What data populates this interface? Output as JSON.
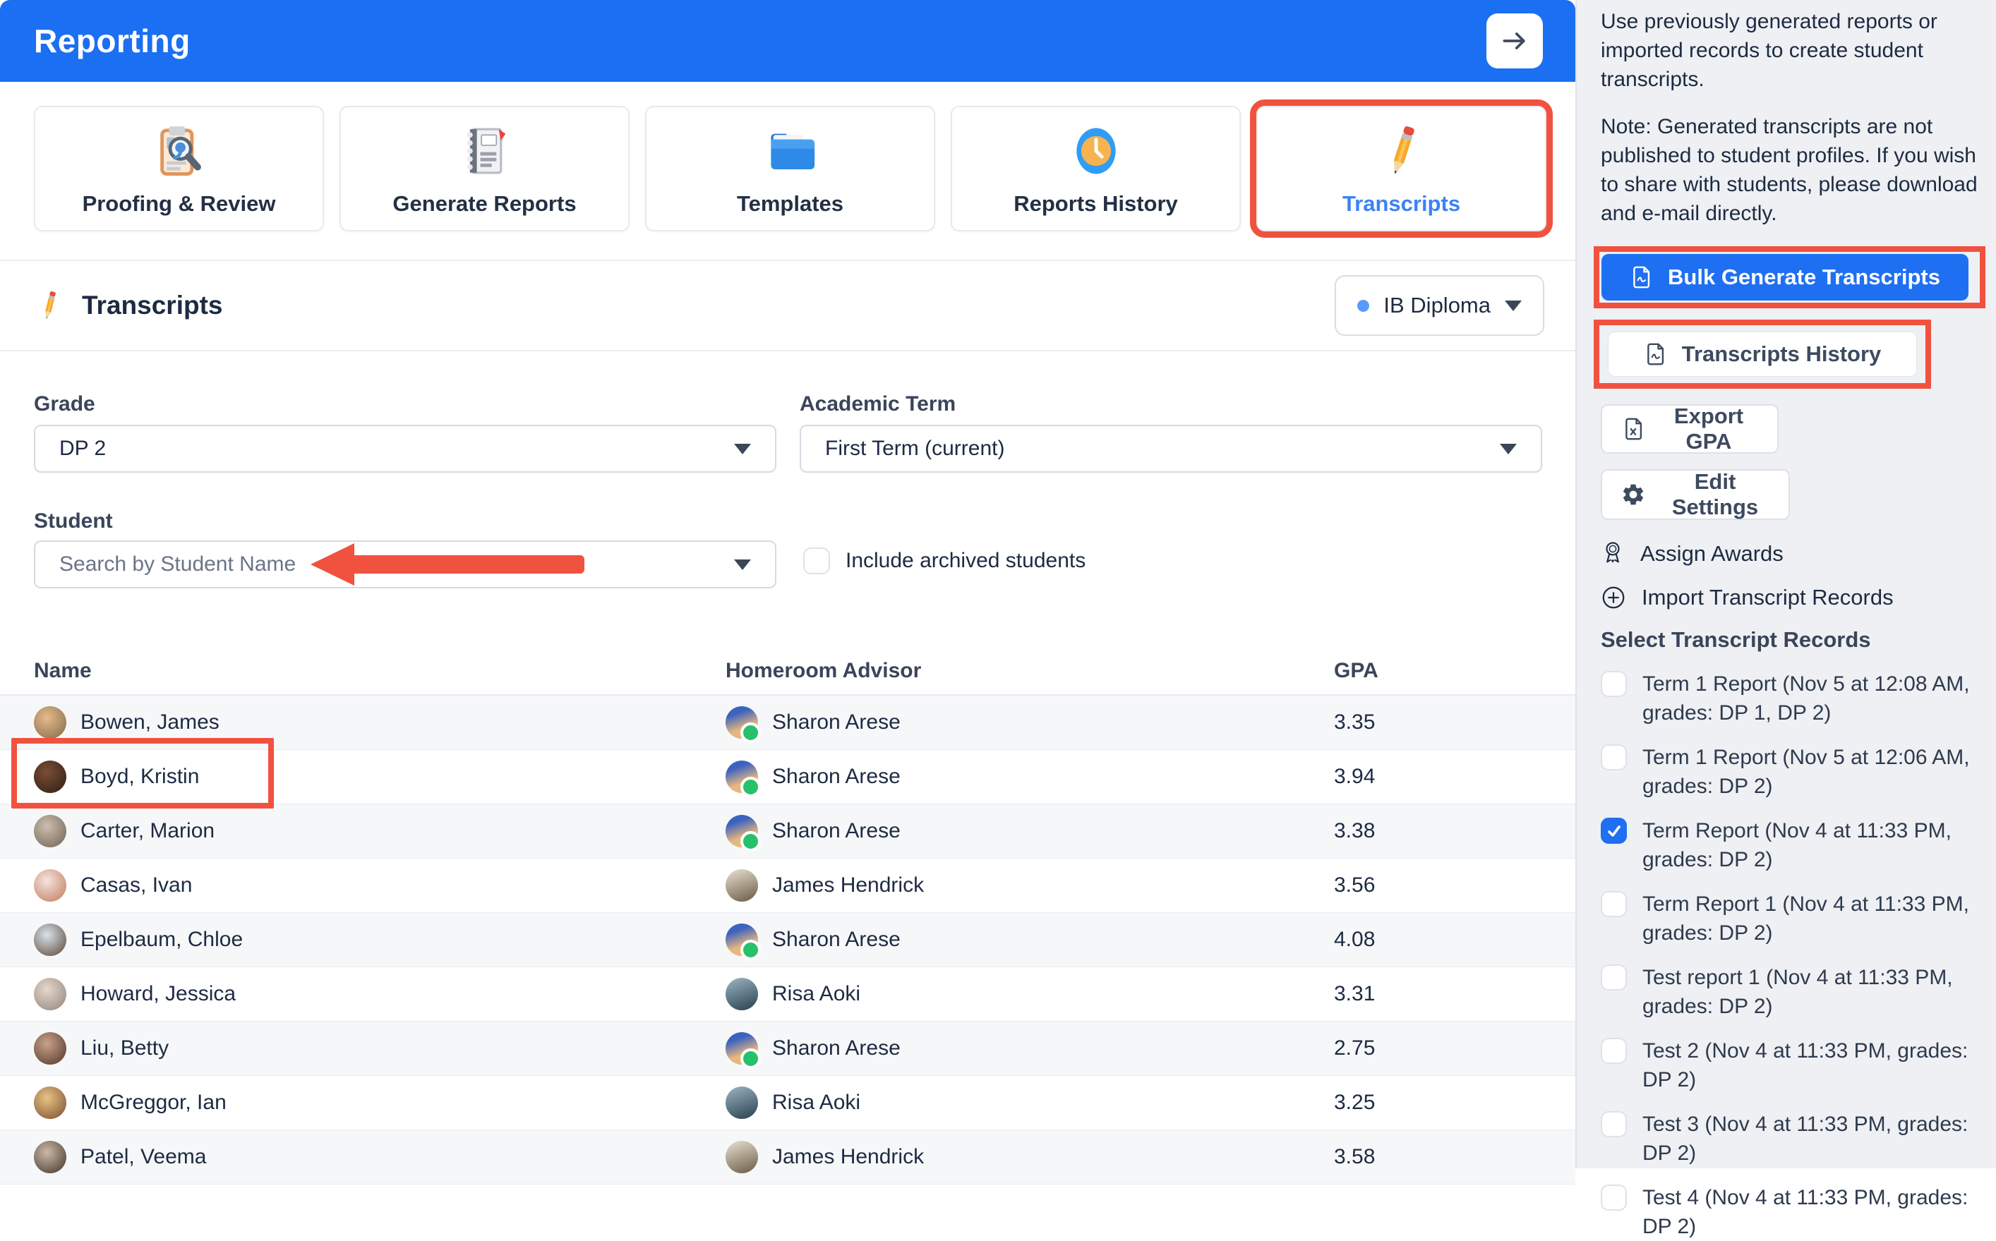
{
  "header": {
    "title": "Reporting",
    "collapse_icon": "arrow-right-icon"
  },
  "tabs": [
    {
      "label": "Proofing & Review",
      "icon": "proofing-review-icon",
      "active": false
    },
    {
      "label": "Generate Reports",
      "icon": "report-cards-icon",
      "active": false
    },
    {
      "label": "Templates",
      "icon": "folder-icon",
      "active": false
    },
    {
      "label": "Reports History",
      "icon": "clock-icon",
      "active": false
    },
    {
      "label": "Transcripts",
      "icon": "pencil-icon",
      "active": true,
      "annotated": true
    }
  ],
  "section": {
    "title": "Transcripts",
    "icon": "pencil-icon",
    "program_selector": {
      "label": "IB Diploma",
      "dot_color": "#5b9bf8"
    }
  },
  "filters": {
    "grade": {
      "label": "Grade",
      "value": "DP 2"
    },
    "academic_term": {
      "label": "Academic Term",
      "value": "First Term (current)"
    },
    "student": {
      "label": "Student",
      "placeholder": "Search by Student Name",
      "annotated_with_arrow": true
    },
    "include_archived": {
      "label": "Include archived students",
      "checked": false
    }
  },
  "table": {
    "columns": {
      "name": "Name",
      "advisor": "Homeroom Advisor",
      "gpa": "GPA"
    },
    "rows": [
      {
        "name": "Bowen, James",
        "advisor": "Sharon Arese",
        "gpa": "3.35",
        "advisor_online": true,
        "annotated": false
      },
      {
        "name": "Boyd, Kristin",
        "advisor": "Sharon Arese",
        "gpa": "3.94",
        "advisor_online": true,
        "annotated": true
      },
      {
        "name": "Carter, Marion",
        "advisor": "Sharon Arese",
        "gpa": "3.38",
        "advisor_online": true,
        "annotated": false
      },
      {
        "name": "Casas, Ivan",
        "advisor": "James Hendrick",
        "gpa": "3.56",
        "advisor_online": false,
        "annotated": false
      },
      {
        "name": "Epelbaum, Chloe",
        "advisor": "Sharon Arese",
        "gpa": "4.08",
        "advisor_online": true,
        "annotated": false
      },
      {
        "name": "Howard, Jessica",
        "advisor": "Risa Aoki",
        "gpa": "3.31",
        "advisor_online": false,
        "annotated": false
      },
      {
        "name": "Liu, Betty",
        "advisor": "Sharon Arese",
        "gpa": "2.75",
        "advisor_online": true,
        "annotated": false
      },
      {
        "name": "McGreggor, Ian",
        "advisor": "Risa Aoki",
        "gpa": "3.25",
        "advisor_online": false,
        "annotated": false
      },
      {
        "name": "Patel, Veema",
        "advisor": "James Hendrick",
        "gpa": "3.58",
        "advisor_online": false,
        "annotated": false
      }
    ]
  },
  "sidebar": {
    "intro": "Use previously generated reports or imported records to create student transcripts.",
    "note": "Note: Generated transcripts are not published to student profiles. If you wish to share with students, please download and e-mail directly.",
    "buttons": {
      "bulk": {
        "label": "Bulk Generate Transcripts",
        "icon": "pdf-file-icon",
        "annotated": true
      },
      "history": {
        "label": "Transcripts History",
        "icon": "pdf-file-icon",
        "annotated": true
      },
      "export_gpa": {
        "label": "Export GPA",
        "icon": "excel-file-icon",
        "annotated": false
      },
      "edit_settings": {
        "label": "Edit Settings",
        "icon": "gear-icon",
        "annotated": false
      }
    },
    "links": {
      "assign_awards": {
        "label": "Assign Awards",
        "icon": "award-icon"
      },
      "import_records": {
        "label": "Import Transcript Records",
        "icon": "plus-circle-icon"
      }
    },
    "records": {
      "heading": "Select Transcript Records",
      "items": [
        {
          "label": "Term 1 Report (Nov 5 at 12:08 AM, grades: DP 1, DP 2)",
          "checked": false
        },
        {
          "label": "Term 1 Report (Nov 5 at 12:06 AM, grades: DP 2)",
          "checked": false
        },
        {
          "label": "Term Report (Nov 4 at 11:33 PM, grades: DP 2)",
          "checked": true
        },
        {
          "label": "Term Report 1 (Nov 4 at 11:33 PM, grades: DP 2)",
          "checked": false
        },
        {
          "label": "Test report 1 (Nov 4 at 11:33 PM, grades: DP 2)",
          "checked": false
        },
        {
          "label": "Test 2 (Nov 4 at 11:33 PM, grades: DP 2)",
          "checked": false
        },
        {
          "label": "Test 3 (Nov 4 at 11:33 PM, grades: DP 2)",
          "checked": false
        },
        {
          "label": "Test 4 (Nov 4 at 11:33 PM, grades: DP 2)",
          "checked": false
        }
      ]
    }
  },
  "colors": {
    "header_blue": "#1b6ff2",
    "primary_button_blue": "#1f6ff2",
    "active_tab_blue": "#3b82f6",
    "annotation_red": "#f0523f",
    "presence_green": "#27c16b",
    "sidebar_bg": "#eef0f3",
    "row_stripe": "#f6f7f9"
  }
}
